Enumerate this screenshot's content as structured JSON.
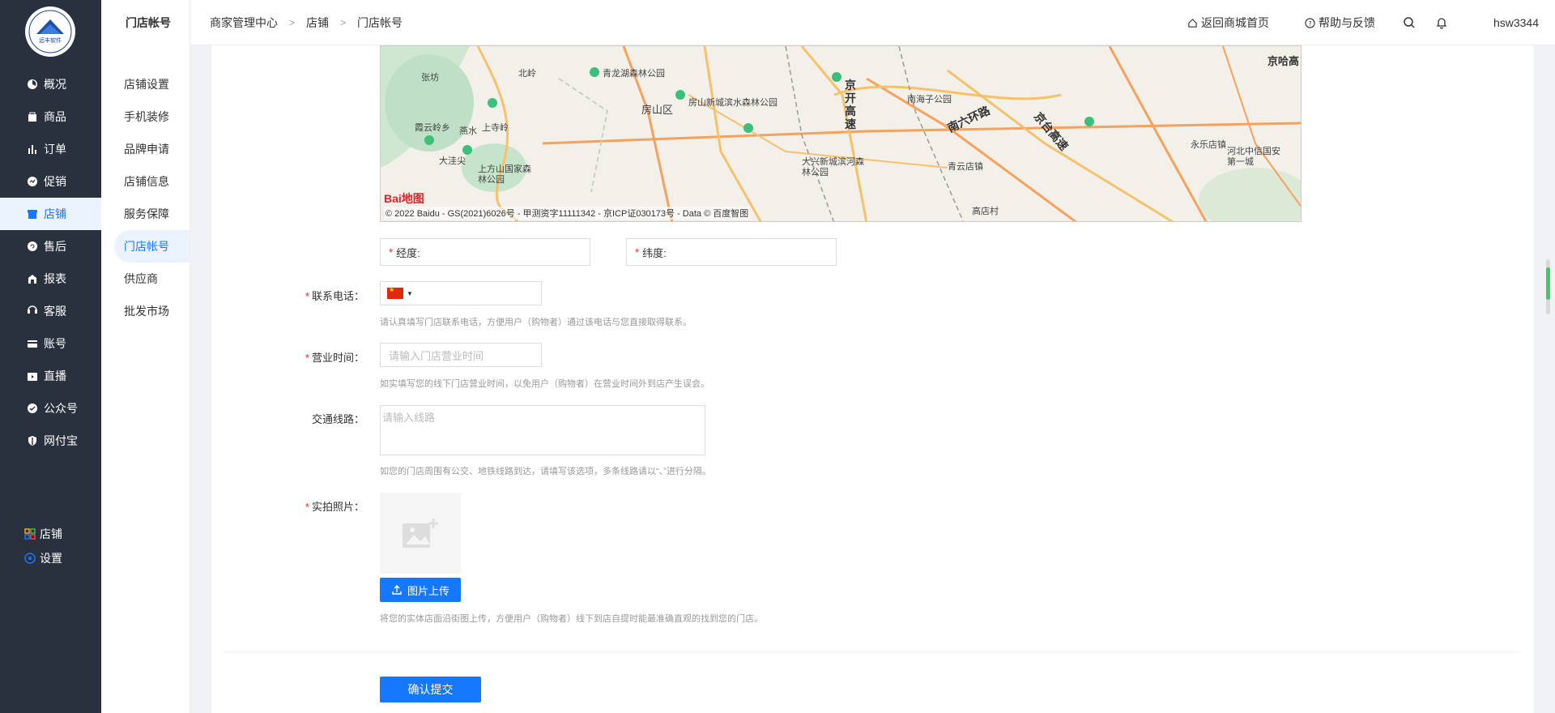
{
  "sidebar": {
    "logo_text": "远丰软件",
    "items": [
      {
        "label": "概况",
        "icon": "dashboard-icon"
      },
      {
        "label": "商品",
        "icon": "bag-icon"
      },
      {
        "label": "订单",
        "icon": "chart-icon"
      },
      {
        "label": "促销",
        "icon": "promo-icon"
      },
      {
        "label": "店铺",
        "icon": "store-icon"
      },
      {
        "label": "售后",
        "icon": "aftersale-icon"
      },
      {
        "label": "报表",
        "icon": "report-icon"
      },
      {
        "label": "客服",
        "icon": "service-icon"
      },
      {
        "label": "账号",
        "icon": "account-icon"
      },
      {
        "label": "直播",
        "icon": "live-icon"
      },
      {
        "label": "公众号",
        "icon": "official-icon"
      },
      {
        "label": "网付宝",
        "icon": "shield-icon"
      }
    ],
    "bottom": [
      {
        "label": "店铺",
        "icon": "grid-icon"
      },
      {
        "label": "设置",
        "icon": "settings-icon"
      }
    ],
    "active_color": "#1677ff"
  },
  "subnav": {
    "title": "门店帐号",
    "items": [
      "店铺设置",
      "手机装修",
      "品牌申请",
      "店铺信息",
      "服务保障",
      "门店帐号",
      "供应商",
      "批发市场"
    ]
  },
  "topbar": {
    "breadcrumb": [
      "商家管理中心",
      "店铺",
      "门店帐号"
    ],
    "home_link": "返回商城首页",
    "help_link": "帮助与反馈",
    "username": "hsw3344"
  },
  "map": {
    "labels": [
      "青龙湖森林公园",
      "房山区",
      "房山新城滨水森林公园",
      "南海子公园",
      "上寺岭",
      "霞云岭乡",
      "大洼尖",
      "上方山国家森林公园",
      "大兴新城滨河森林公园",
      "青云店镇",
      "永乐店镇",
      "河北中信国安第一城",
      "高店村",
      "北岭",
      "张坊",
      "燕水",
      "京开高速",
      "南六环路",
      "京台高速",
      "京哈高"
    ],
    "copyright": "© 2022 Baidu - GS(2021)6026号 - 甲测资字11111342 - 京ICP证030173号 - Data © 百度智图",
    "logo": "Bai地图"
  },
  "form": {
    "longitude_label": "经度:",
    "latitude_label": "纬度:",
    "phone_label": "联系电话：",
    "phone_help": "请认真填写门店联系电话，方便用户（购物者）通过该电话与您直接取得联系。",
    "hours_label": "营业时间：",
    "hours_placeholder": "请输入门店营业时间",
    "hours_help": "如实填写您的线下门店营业时间，以免用户（购物者）在营业时间外到店产生误会。",
    "route_label": "交通线路：",
    "route_placeholder": "请输入线路",
    "route_help": "如您的门店周围有公交、地铁线路到达，请填写该选项，多条线路请以“、”进行分隔。",
    "photo_label": "实拍照片：",
    "upload_button": "图片上传",
    "photo_help": "将您的实体店面沿街图上传，方便用户（购物者）线下到店自提时能最准确直观的找到您的门店。",
    "submit_button": "确认提交"
  }
}
